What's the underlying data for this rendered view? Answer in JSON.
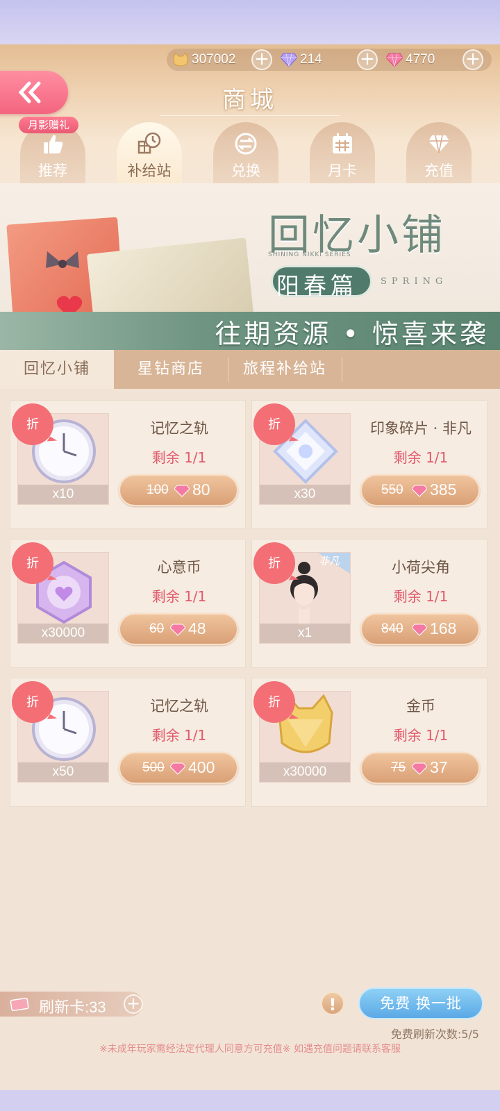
{
  "currency": {
    "coins": "307002",
    "diamonds": "214",
    "stars": "4770"
  },
  "header": {
    "title": "商城",
    "promo_badge": "月影赠礼"
  },
  "tabs": [
    {
      "label": "推荐",
      "active": false
    },
    {
      "label": "补给站",
      "active": true
    },
    {
      "label": "兑换",
      "active": false
    },
    {
      "label": "月卡",
      "active": false
    },
    {
      "label": "充值",
      "active": false
    }
  ],
  "banner": {
    "title": "回忆小铺",
    "series_en": "SHINING NIKKI SERIES",
    "edition": "阳春篇",
    "edition_en": "SPRING",
    "slogan": "往期资源 • 惊喜来袭"
  },
  "subtabs": [
    {
      "label": "回忆小铺",
      "active": true
    },
    {
      "label": "星钻商店",
      "active": false
    },
    {
      "label": "旅程补给站",
      "active": false
    }
  ],
  "discount_label": "折",
  "items": [
    {
      "name": "记忆之轨",
      "remaining": "剩余 1/1",
      "qty": "x10",
      "old_price": "100",
      "price": "80",
      "icon": "clock-icon"
    },
    {
      "name": "印象碎片 · 非凡",
      "remaining": "剩余 1/1",
      "qty": "x30",
      "old_price": "550",
      "price": "385",
      "icon": "crystal-icon"
    },
    {
      "name": "心意币",
      "remaining": "剩余 1/1",
      "qty": "x30000",
      "old_price": "60",
      "price": "48",
      "icon": "heart-coin-icon"
    },
    {
      "name": "小荷尖角",
      "remaining": "剩余 1/1",
      "qty": "x1",
      "old_price": "840",
      "price": "168",
      "icon": "hairstyle-icon",
      "tag": "非凡"
    },
    {
      "name": "记忆之轨",
      "remaining": "剩余 1/1",
      "qty": "x50",
      "old_price": "500",
      "price": "400",
      "icon": "clock-icon"
    },
    {
      "name": "金币",
      "remaining": "剩余 1/1",
      "qty": "x30000",
      "old_price": "75",
      "price": "37",
      "icon": "gold-coin-icon"
    }
  ],
  "footer": {
    "refresh_card": "刷新卡:33",
    "swap_button": "免费  换一批",
    "free_refresh": "免费刷新次数:5/5",
    "notice": "※未成年玩家需经法定代理人同意方可充值※ 如遇充值问题请联系客服"
  },
  "colors": {
    "accent_pink": "#f36f75",
    "price_button": "#d9a076",
    "swap_blue": "#5aa9e6",
    "remain_text": "#e05a6d"
  }
}
